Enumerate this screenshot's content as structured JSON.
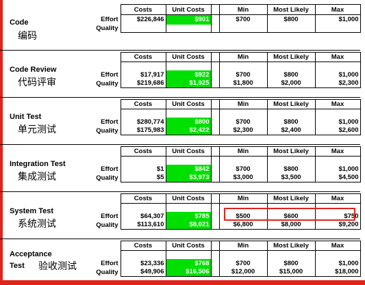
{
  "header": {
    "costs": "Costs",
    "unit_costs": "Unit Costs",
    "min": "Min",
    "most_likely": "Most Likely",
    "max": "Max"
  },
  "row_labels": {
    "effort": "Effort",
    "quality": "Quality"
  },
  "phases": [
    {
      "name": "Code",
      "name_zh": "编码",
      "effort": {
        "costs": "$226,846",
        "unit_costs": "$901",
        "min": "$700",
        "most_likely": "$800",
        "max": "$1,000"
      },
      "quality": {
        "costs": "",
        "unit_costs": "",
        "min": "",
        "most_likely": "",
        "max": ""
      }
    },
    {
      "name": "Code Review",
      "name_zh": "代码评审",
      "effort": {
        "costs": "$17,917",
        "unit_costs": "$922",
        "min": "$700",
        "most_likely": "$800",
        "max": "$1,000"
      },
      "quality": {
        "costs": "$219,686",
        "unit_costs": "$1,925",
        "min": "$1,800",
        "most_likely": "$2,000",
        "max": "$2,300"
      }
    },
    {
      "name": "Unit Test",
      "name_zh": "单元测试",
      "effort": {
        "costs": "$280,774",
        "unit_costs": "$800",
        "min": "$700",
        "most_likely": "$800",
        "max": "$1,000"
      },
      "quality": {
        "costs": "$175,983",
        "unit_costs": "$2,422",
        "min": "$2,300",
        "most_likely": "$2,400",
        "max": "$2,600"
      }
    },
    {
      "name": "Integration Test",
      "name_zh": "集成测试",
      "effort": {
        "costs": "$1",
        "unit_costs": "$842",
        "min": "$700",
        "most_likely": "$800",
        "max": "$1,000"
      },
      "quality": {
        "costs": "$5",
        "unit_costs": "$3,973",
        "min": "$3,000",
        "most_likely": "$3,500",
        "max": "$4,500"
      }
    },
    {
      "name": "System Test",
      "name_zh": "系统测试",
      "effort": {
        "costs": "$64,307",
        "unit_costs": "$785",
        "min": "$500",
        "most_likely": "$600",
        "max": "$750"
      },
      "quality": {
        "costs": "$113,610",
        "unit_costs": "$8,021",
        "min": "$6,800",
        "most_likely": "$8,000",
        "max": "$9,200"
      }
    },
    {
      "name": "Acceptance Test",
      "name_zh": "验收测试",
      "effort": {
        "costs": "$23,336",
        "unit_costs": "$768",
        "min": "$700",
        "most_likely": "$800",
        "max": "$1,000"
      },
      "quality": {
        "costs": "$49,906",
        "unit_costs": "$16,506",
        "min": "$12,000",
        "most_likely": "$15,000",
        "max": "$18,000"
      }
    }
  ],
  "colors": {
    "highlight_cell": "#00e000",
    "frame_red": "#e0241c"
  }
}
